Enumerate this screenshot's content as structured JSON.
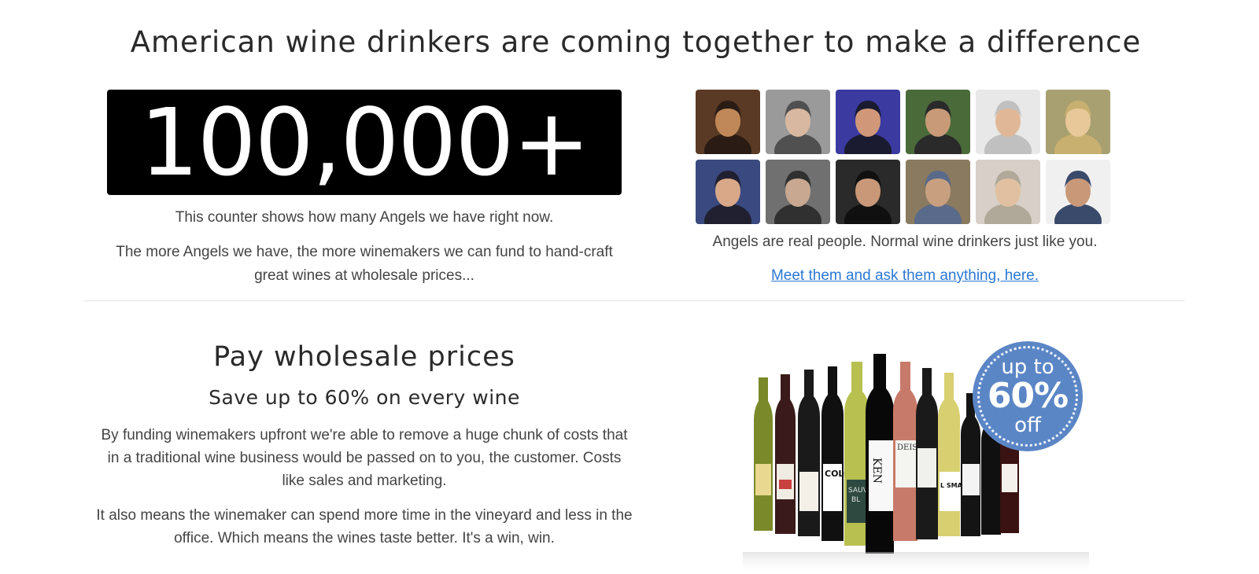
{
  "header": {
    "title": "American wine drinkers are coming together to make a difference"
  },
  "counter": {
    "value": "100,000+",
    "caption": "This counter shows how many Angels we have right now.",
    "description": "The more Angels we have, the more winemakers we can fund to hand-craft great wines at wholesale prices..."
  },
  "angels": {
    "photos": [
      {
        "name": "angel-photo-1",
        "colors": [
          "#5a3a24",
          "#c08858",
          "#2a1c14"
        ]
      },
      {
        "name": "angel-photo-2",
        "colors": [
          "#9a9a9a",
          "#d8b8a0",
          "#505050"
        ]
      },
      {
        "name": "angel-photo-3",
        "colors": [
          "#3a3aa0",
          "#d09878",
          "#1a1a30"
        ]
      },
      {
        "name": "angel-photo-4",
        "colors": [
          "#4a6a3a",
          "#c89a78",
          "#2a2a2a"
        ]
      },
      {
        "name": "angel-photo-5",
        "colors": [
          "#e8e8e8",
          "#e0b898",
          "#c0c0c0"
        ]
      },
      {
        "name": "angel-photo-6",
        "colors": [
          "#a8a070",
          "#e8c898",
          "#c8b070"
        ]
      },
      {
        "name": "angel-photo-7",
        "colors": [
          "#3a4a80",
          "#d8a888",
          "#202030"
        ]
      },
      {
        "name": "angel-photo-8",
        "colors": [
          "#707070",
          "#c8a890",
          "#303030"
        ]
      },
      {
        "name": "angel-photo-9",
        "colors": [
          "#2a2a2a",
          "#c89878",
          "#101010"
        ]
      },
      {
        "name": "angel-photo-10",
        "colors": [
          "#8a7a60",
          "#c8a080",
          "#5a6a8a"
        ]
      },
      {
        "name": "angel-photo-11",
        "colors": [
          "#d8d0c8",
          "#e0c0a0",
          "#b0a898"
        ]
      },
      {
        "name": "angel-photo-12",
        "colors": [
          "#f0f0f0",
          "#c89878",
          "#3a4a6a"
        ]
      }
    ],
    "caption": "Angels are real people. Normal wine drinkers just like you.",
    "link_text": "Meet them and ask them anything, here."
  },
  "wholesale": {
    "heading": "Pay wholesale prices",
    "subheading": "Save up to 60% on every wine",
    "paragraph1": "By funding winemakers upfront we're able to remove a huge chunk of costs that in a traditional wine business would be passed on to you, the customer. Costs like sales and marketing.",
    "paragraph2": "It also means the winemaker can spend more time in the vineyard and less in the office. Which means the wines taste better. It's a win, win."
  },
  "badge": {
    "line1": "up to",
    "line2": "60%",
    "line3": "off"
  },
  "bottles": {
    "label_ken": "KEN",
    "label_colo": "COLO",
    "label_sauv": "SAUV",
    "label_bl": "BL",
    "label_small": "L SMALL",
    "label_deis": "DEIS"
  },
  "colors": {
    "link": "#2b78d4",
    "badge": "#5b86c6",
    "counter_bg": "#000000"
  }
}
